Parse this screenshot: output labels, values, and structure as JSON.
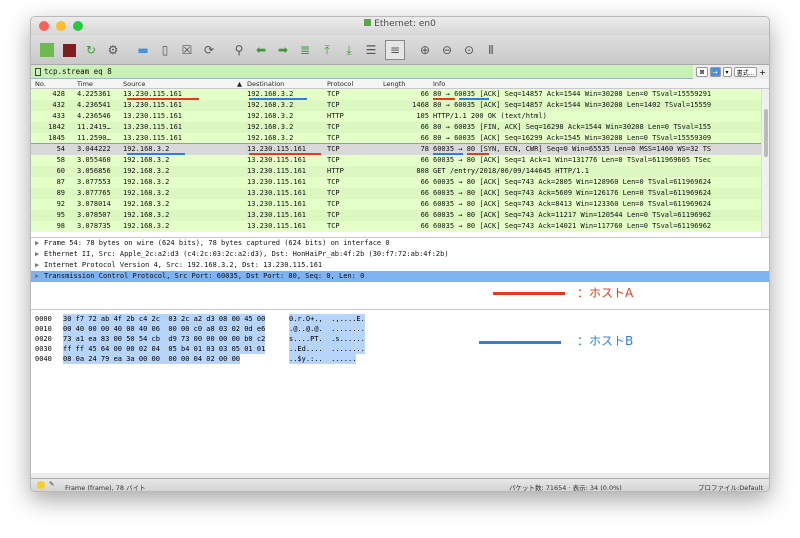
{
  "window": {
    "title": "Ethernet: en0"
  },
  "filter": {
    "text": "tcp.stream eq 8",
    "expression_label": "書式...",
    "plus": "+"
  },
  "columns": {
    "no": "No.",
    "time": "Time",
    "source": "Source",
    "destination": "Destination",
    "protocol": "Protocol",
    "length": "Length",
    "info": "Info"
  },
  "packets": [
    {
      "no": "428",
      "time": "4.225361",
      "src": "13.230.115.161",
      "dst": "192.168.3.2",
      "proto": "TCP",
      "len": "66",
      "info": "80 → 60035 [ACK] Seq=14857 Ack=1544 Win=30208 Len=0 TSval=15559291",
      "style": "green"
    },
    {
      "no": "432",
      "time": "4.236541",
      "src": "13.230.115.161",
      "dst": "192.168.3.2",
      "proto": "TCP",
      "len": "1468",
      "info": "80 → 60035 [ACK] Seq=14857 Ack=1544 Win=30208 Len=1402 TSval=15559",
      "style": "green"
    },
    {
      "no": "433",
      "time": "4.236546",
      "src": "13.230.115.161",
      "dst": "192.168.3.2",
      "proto": "HTTP",
      "len": "105",
      "info": "HTTP/1.1 200 OK  (text/html)",
      "style": "green"
    },
    {
      "no": "1842",
      "time": "11.2419…",
      "src": "13.230.115.161",
      "dst": "192.168.3.2",
      "proto": "TCP",
      "len": "66",
      "info": "80 → 60035 [FIN, ACK] Seq=16298 Ack=1544 Win=30208 Len=0 TSval=155",
      "style": "green"
    },
    {
      "no": "1845",
      "time": "11.2590…",
      "src": "13.230.115.161",
      "dst": "192.168.3.2",
      "proto": "TCP",
      "len": "66",
      "info": "80 → 60035 [ACK] Seq=16299 Ack=1545 Win=30208 Len=0 TSval=15559309",
      "style": "green"
    },
    {
      "no": "54",
      "time": "3.044222",
      "src": "192.168.3.2",
      "dst": "13.230.115.161",
      "proto": "TCP",
      "len": "78",
      "info": "60035 → 80 [SYN, ECN, CWR] Seq=0 Win=65535 Len=0 MSS=1460 WS=32 TS",
      "style": "selected"
    },
    {
      "no": "58",
      "time": "3.055460",
      "src": "192.168.3.2",
      "dst": "13.230.115.161",
      "proto": "TCP",
      "len": "66",
      "info": "60035 → 80 [ACK] Seq=1 Ack=1 Win=131776 Len=0 TSval=611969605 TSec",
      "style": "green"
    },
    {
      "no": "60",
      "time": "3.056856",
      "src": "192.168.3.2",
      "dst": "13.230.115.161",
      "proto": "HTTP",
      "len": "808",
      "info": "GET /entry/2018/06/09/144645 HTTP/1.1",
      "style": "green"
    },
    {
      "no": "87",
      "time": "3.077553",
      "src": "192.168.3.2",
      "dst": "13.230.115.161",
      "proto": "TCP",
      "len": "66",
      "info": "60035 → 80 [ACK] Seq=743 Ack=2805 Win=128960 Len=0 TSval=611969624",
      "style": "green"
    },
    {
      "no": "89",
      "time": "3.077765",
      "src": "192.168.3.2",
      "dst": "13.230.115.161",
      "proto": "TCP",
      "len": "66",
      "info": "60035 → 80 [ACK] Seq=743 Ack=5609 Win=126176 Len=0 TSval=611969624",
      "style": "green"
    },
    {
      "no": "92",
      "time": "3.078014",
      "src": "192.168.3.2",
      "dst": "13.230.115.161",
      "proto": "TCP",
      "len": "66",
      "info": "60035 → 80 [ACK] Seq=743 Ack=8413 Win=123360 Len=0 TSval=611969624",
      "style": "green"
    },
    {
      "no": "95",
      "time": "3.078507",
      "src": "192.168.3.2",
      "dst": "13.230.115.161",
      "proto": "TCP",
      "len": "66",
      "info": "60035 → 80 [ACK] Seq=743 Ack=11217 Win=120544 Len=0 TSval=61196962",
      "style": "green"
    },
    {
      "no": "98",
      "time": "3.078735",
      "src": "192.168.3.2",
      "dst": "13.230.115.161",
      "proto": "TCP",
      "len": "66",
      "info": "60035 → 80 [ACK] Seq=743 Ack=14021 Win=117760 Len=0 TSval=61196962",
      "style": "green"
    }
  ],
  "details": [
    {
      "text": "Frame 54: 78 bytes on wire (624 bits), 78 bytes captured (624 bits) on interface 0",
      "selected": false
    },
    {
      "text": "Ethernet II, Src: Apple_2c:a2:d3 (c4:2c:03:2c:a2:d3), Dst: HonHaiPr_ab:4f:2b (30:f7:72:ab:4f:2b)",
      "selected": false
    },
    {
      "text": "Internet Protocol Version 4, Src: 192.168.3.2, Dst: 13.230.115.161",
      "selected": false
    },
    {
      "text": "Transmission Control Protocol, Src Port: 60035, Dst Port: 80, Seq: 0, Len: 0",
      "selected": true
    }
  ],
  "hex": [
    {
      "offset": "0000",
      "bytes": "30 f7 72 ab 4f 2b c4 2c  03 2c a2 d3 08 00 45 00",
      "ascii": "0.r.O+.,  .,....E."
    },
    {
      "offset": "0010",
      "bytes": "00 40 00 00 40 00 40 06  00 00 c0 a8 03 02 0d e6",
      "ascii": ".@..@.@.  ........"
    },
    {
      "offset": "0020",
      "bytes": "73 a1 ea 83 00 50 54 cb  d9 73 00 00 00 00 b0 c2",
      "ascii": "s....PT.  .s......"
    },
    {
      "offset": "0030",
      "bytes": "ff ff 45 64 00 00 02 04  05 b4 01 03 03 05 01 01",
      "ascii": "..Ed....  ........"
    },
    {
      "offset": "0040",
      "bytes": "08 0a 24 79 ea 3a 00 00  00 00 04 02 00 00",
      "ascii": "..$y.:..  ......"
    }
  ],
  "annotations": {
    "host_a": "：ホストA",
    "host_b": "：ホストB",
    "host_a_color": "#e8391d",
    "host_b_color": "#2f7fe0"
  },
  "status": {
    "left": "Frame (frame), 78 バイト",
    "packets": "パケット数: 71654 · 表示: 34 (0.0%)",
    "profile": "プロファイル:Default"
  }
}
